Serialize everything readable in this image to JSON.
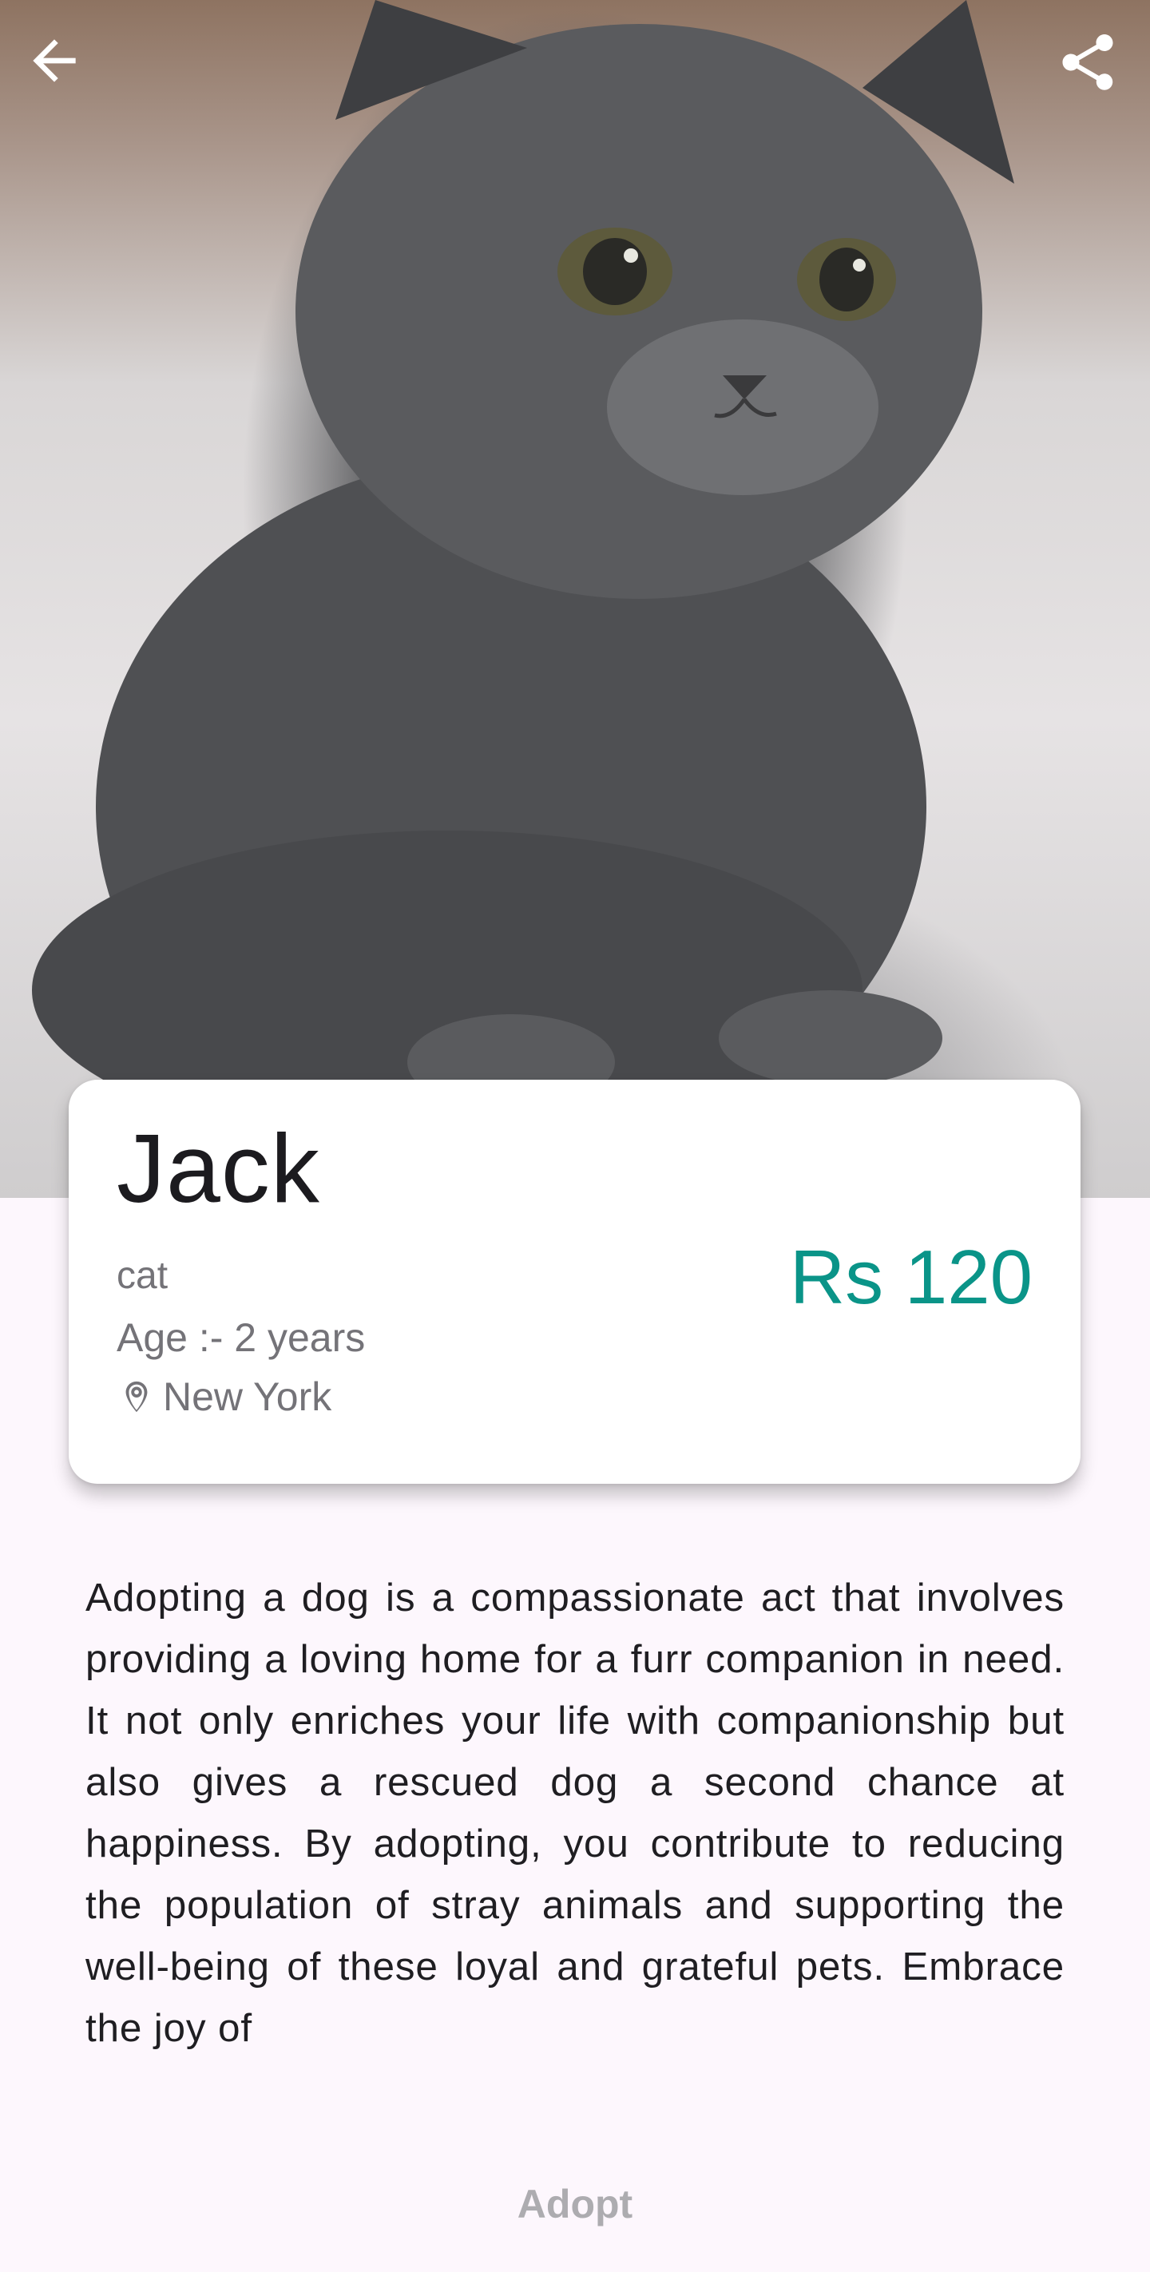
{
  "hero": {
    "image_alt": "gray kitten",
    "icons": {
      "back": "arrow-back-icon",
      "share": "share-icon"
    }
  },
  "pet": {
    "name": "Jack",
    "type": "cat",
    "age": "Age :- 2 years",
    "location": "New York",
    "location_icon": "location-pin-icon",
    "price": "Rs 120"
  },
  "description": "Adopting a dog is a compassionate act that involves providing a loving home for a furr companion in need. It not only enriches your life with companionship but also gives a rescued dog a second chance at happiness. By adopting, you contribute to reducing the population of stray animals and supporting the well-being of these loyal and grateful pets. Embrace the joy of",
  "actions": {
    "adopt_label": "Adopt"
  },
  "colors": {
    "price": "#0a9488",
    "background": "#fdf7fd",
    "muted_text": "#747378",
    "disabled_button_text": "#adacb0"
  }
}
